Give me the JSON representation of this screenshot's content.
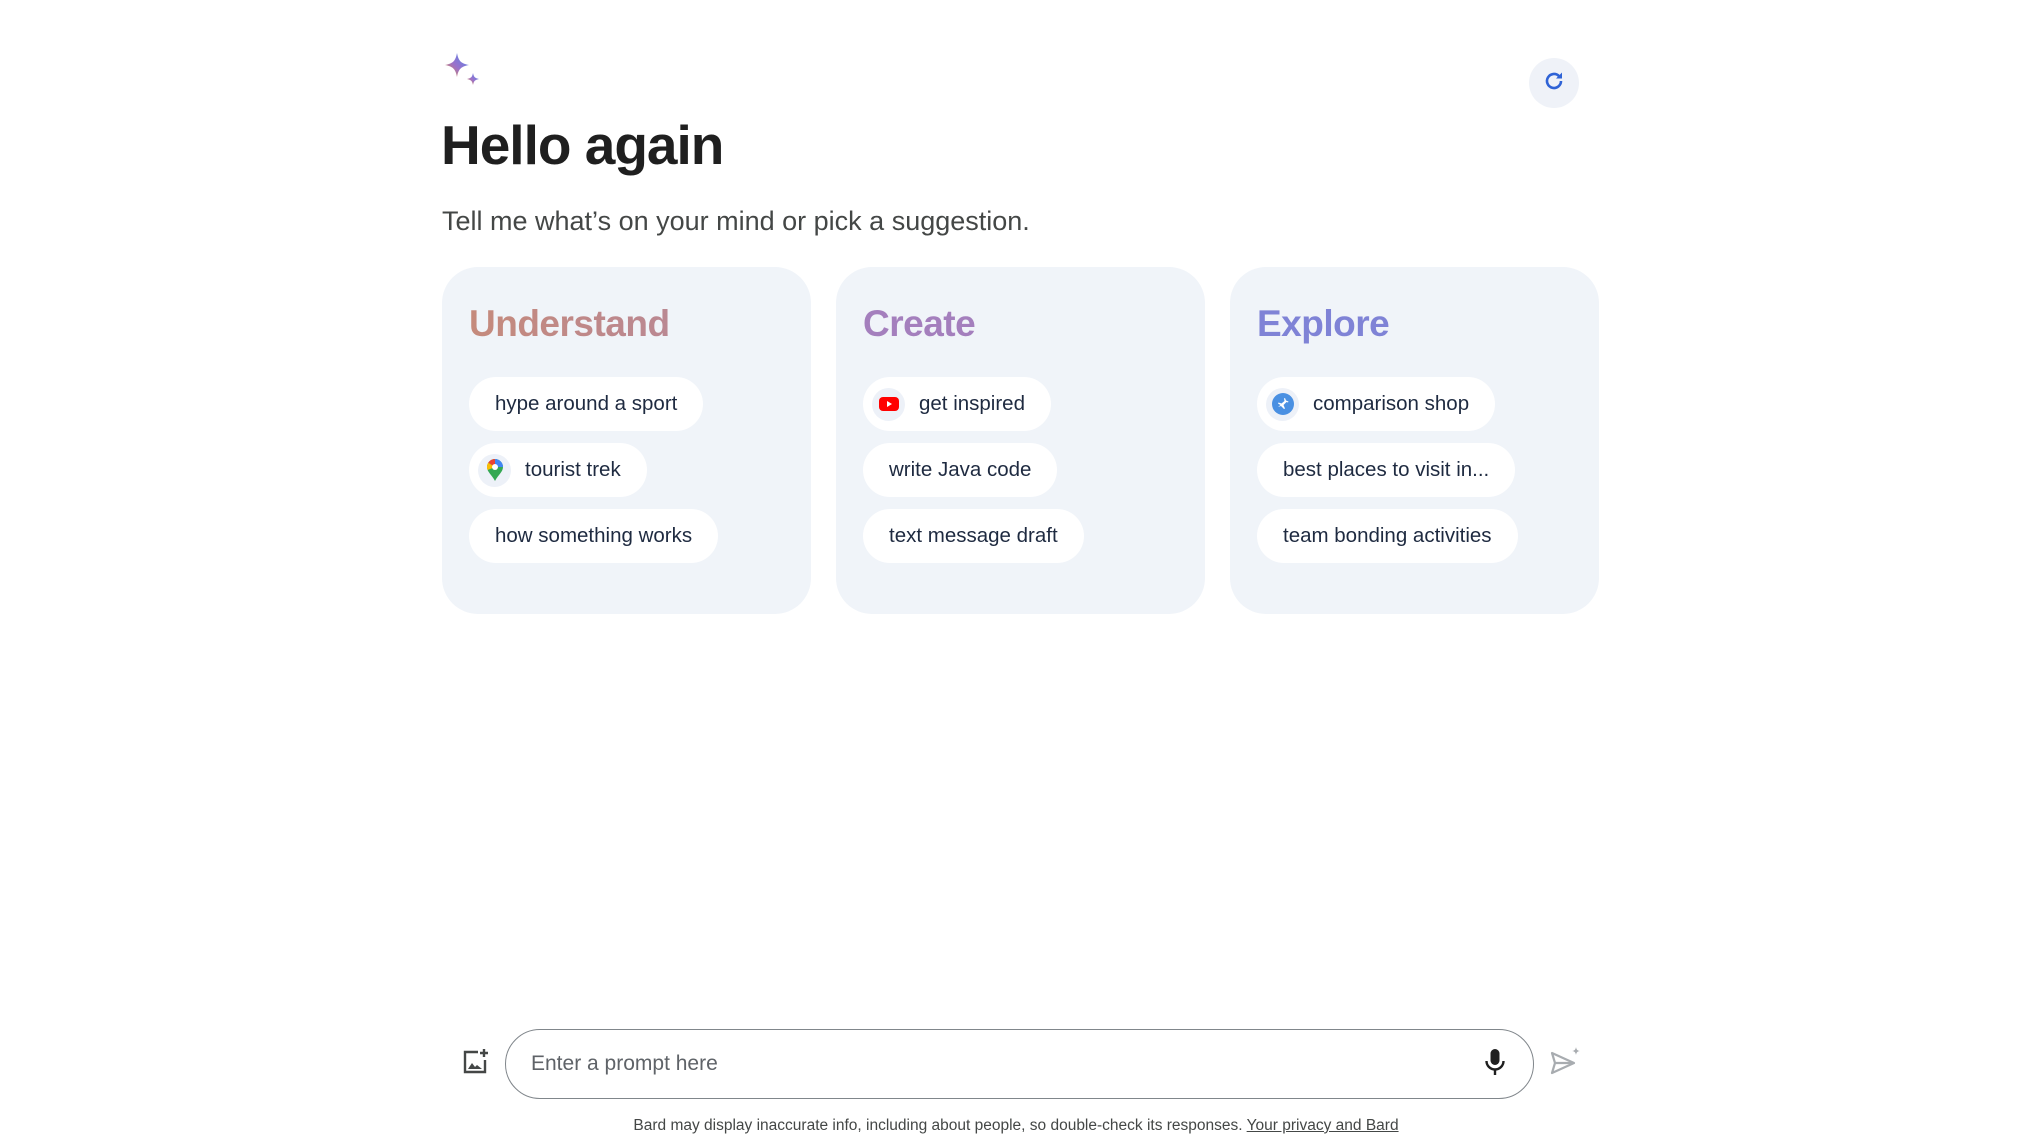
{
  "header": {
    "logo_icon": "bard-sparkle-icon",
    "refresh_icon": "refresh-icon",
    "title": "Hello again",
    "subtitle": "Tell me what’s on your mind or pick a suggestion."
  },
  "colors": {
    "understand": "#c1898a",
    "create": "#a47fbd",
    "explore": "#7f83d6",
    "card_bg": "#f0f4f9",
    "refresh_icon": "#2f63d6"
  },
  "cards": [
    {
      "title": "Understand",
      "chips": [
        {
          "label": "hype around a sport",
          "icon": null
        },
        {
          "label": "tourist trek",
          "icon": "google-maps-pin-icon"
        },
        {
          "label": "how something works",
          "icon": null
        }
      ]
    },
    {
      "title": "Create",
      "chips": [
        {
          "label": "get inspired",
          "icon": "youtube-icon"
        },
        {
          "label": "write Java code",
          "icon": null
        },
        {
          "label": "text message draft",
          "icon": null
        }
      ]
    },
    {
      "title": "Explore",
      "chips": [
        {
          "label": "comparison shop",
          "icon": "google-flights-icon"
        },
        {
          "label": "best places to visit in...",
          "icon": null
        },
        {
          "label": "team bonding activities",
          "icon": null
        }
      ]
    }
  ],
  "prompt": {
    "placeholder": "Enter a prompt here",
    "value": "",
    "image_upload_icon": "add-image-icon",
    "mic_icon": "microphone-icon",
    "send_icon": "send-icon"
  },
  "footer": {
    "disclaimer": "Bard may display inaccurate info, including about people, so double-check its responses. ",
    "privacy_link": "Your privacy and Bard"
  }
}
